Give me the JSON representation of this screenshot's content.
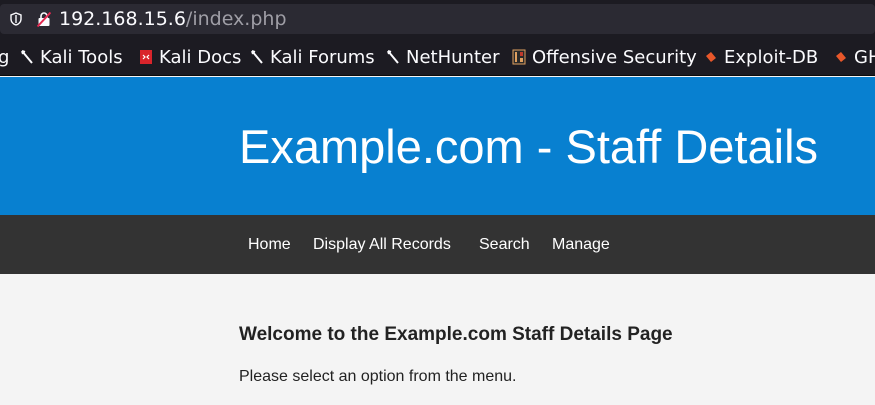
{
  "browser": {
    "url_host": "192.168.15.6",
    "url_path": "/index.php"
  },
  "bookmarks": [
    {
      "label": "g",
      "icon": "none"
    },
    {
      "label": "Kali Tools",
      "icon": "kali-dragon-icon"
    },
    {
      "label": "Kali Docs",
      "icon": "kali-docs-icon"
    },
    {
      "label": "Kali Forums",
      "icon": "kali-dragon-icon"
    },
    {
      "label": "NetHunter",
      "icon": "kali-dragon-icon"
    },
    {
      "label": "Offensive Security",
      "icon": "offsec-icon"
    },
    {
      "label": "Exploit-DB",
      "icon": "exploit-db-icon"
    },
    {
      "label": "GH",
      "icon": "exploit-db-icon"
    }
  ],
  "header": {
    "title": "Example.com - Staff Details"
  },
  "nav": {
    "items": [
      "Home",
      "Display All Records",
      "Search",
      "Manage"
    ]
  },
  "main": {
    "heading": "Welcome to the Example.com Staff Details Page",
    "text": "Please select an option from the menu."
  },
  "colors": {
    "header_bg": "#0880d0",
    "nav_bg": "#333333",
    "page_bg": "#f4f4f4",
    "browser_bg": "#1c1b22"
  }
}
